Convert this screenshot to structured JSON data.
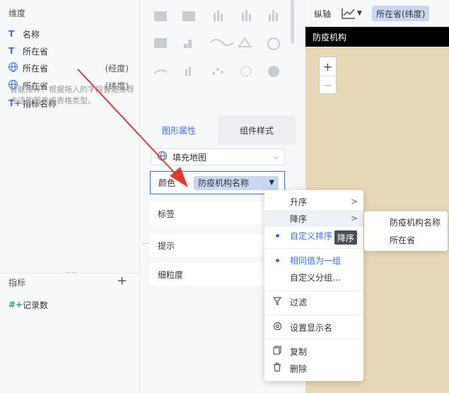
{
  "dimensions": {
    "title": "维度",
    "fields": [
      {
        "icon": "text-type-icon",
        "glyph": "T",
        "label": "名称",
        "suffix": ""
      },
      {
        "icon": "text-type-icon",
        "glyph": "T",
        "label": "所在省",
        "suffix": ""
      },
      {
        "icon": "globe-icon",
        "glyph": "",
        "label": "所在省",
        "suffix": "(经度)"
      },
      {
        "icon": "globe-icon",
        "glyph": "",
        "label": "所在省",
        "suffix": "(纬度)"
      },
      {
        "icon": "text-calc-icon",
        "glyph": "T+",
        "label": "指标名称",
        "suffix": ""
      }
    ]
  },
  "measures": {
    "title": "指标",
    "add_glyph": "+",
    "fields": [
      {
        "icon": "number-calc-icon",
        "glyph": "#+",
        "label": "记录数"
      }
    ]
  },
  "chart_panel": {
    "recommend_text": "智能推荐：根据拖入的字段智能推荐合适的图表或表格类型。",
    "tabs": [
      {
        "label": "图形属性",
        "active": true
      },
      {
        "label": "组件样式",
        "active": false
      }
    ],
    "chart_type_select": {
      "value": "填充地图",
      "icon": "map-globe-icon"
    },
    "color": {
      "label": "颜色",
      "field": "防疫机构名称",
      "dropdown_glyph": "▼"
    },
    "properties": [
      {
        "label": "标签"
      },
      {
        "label": "提示"
      },
      {
        "label": "细粒度"
      }
    ]
  },
  "axis_bar": {
    "label": "纵轴",
    "field": "所在省(纬度)"
  },
  "map": {
    "title": "防疫机构",
    "zoom_in": "+",
    "zoom_out": "−"
  },
  "context_menu": {
    "items": [
      {
        "label": "升序",
        "has_submenu": true
      },
      {
        "label": "降序",
        "has_submenu": true,
        "highlighted": true
      },
      {
        "label": "自定义排序",
        "selected": true
      },
      {
        "label": "相同值为一组",
        "selected": true
      },
      {
        "label": "自定义分组..."
      },
      {
        "label": "过滤",
        "icon": "filter-icon"
      },
      {
        "label": "设置显示名",
        "icon": "gear-icon"
      },
      {
        "label": "复制",
        "icon": "copy-icon"
      },
      {
        "label": "删除",
        "icon": "trash-icon"
      }
    ],
    "tooltip": "降序"
  },
  "submenu": {
    "items": [
      {
        "label": "防疫机构名称"
      },
      {
        "label": "所在省"
      }
    ]
  },
  "colors": {
    "accent": "#3a6fd8",
    "pill_bg": "#c9d7f3",
    "map_bg": "#e8d9b6",
    "arrow": "#e53935"
  }
}
